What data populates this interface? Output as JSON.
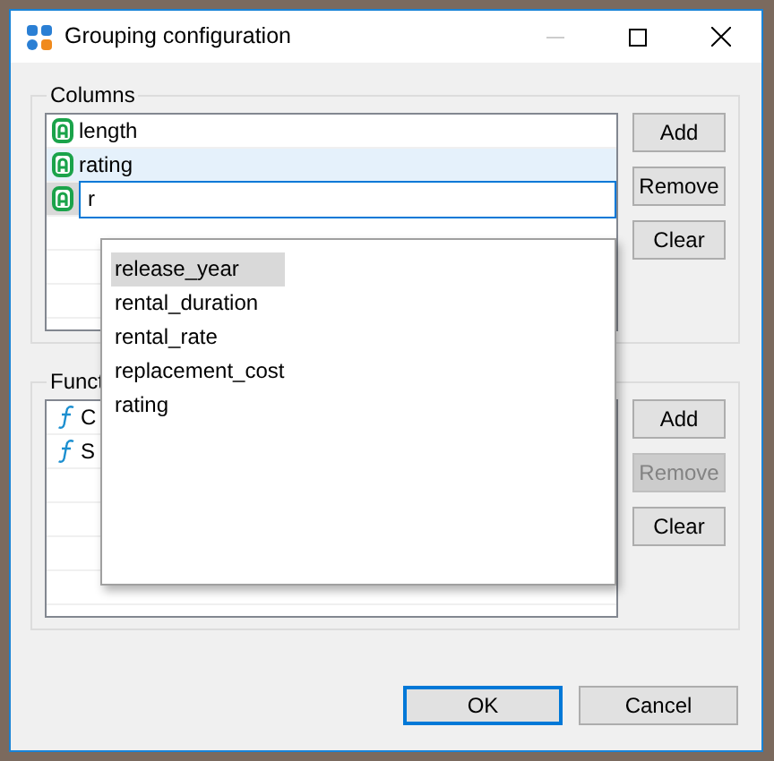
{
  "window": {
    "title": "Grouping configuration"
  },
  "columns": {
    "legend": "Columns",
    "rows": [
      {
        "kind": "item",
        "label": "length",
        "selected": false
      },
      {
        "kind": "item",
        "label": "rating",
        "selected": true
      },
      {
        "kind": "editor",
        "value": "r"
      }
    ],
    "buttons": [
      {
        "label": "Add",
        "disabled": false
      },
      {
        "label": "Remove",
        "disabled": false
      },
      {
        "label": "Clear",
        "disabled": false
      }
    ]
  },
  "functions": {
    "legend": "Funct",
    "rows": [
      {
        "label": "C"
      },
      {
        "label": "S"
      }
    ],
    "buttons": [
      {
        "label": "Add",
        "disabled": false
      },
      {
        "label": "Remove",
        "disabled": true
      },
      {
        "label": "Clear",
        "disabled": false
      }
    ]
  },
  "suggestions": [
    {
      "label": "release_year",
      "selected": true
    },
    {
      "label": "rental_duration",
      "selected": false
    },
    {
      "label": "rental_rate",
      "selected": false
    },
    {
      "label": "replacement_cost",
      "selected": false
    },
    {
      "label": "rating",
      "selected": false
    }
  ],
  "footer": [
    {
      "label": "OK",
      "default": true
    },
    {
      "label": "Cancel",
      "default": false
    }
  ]
}
